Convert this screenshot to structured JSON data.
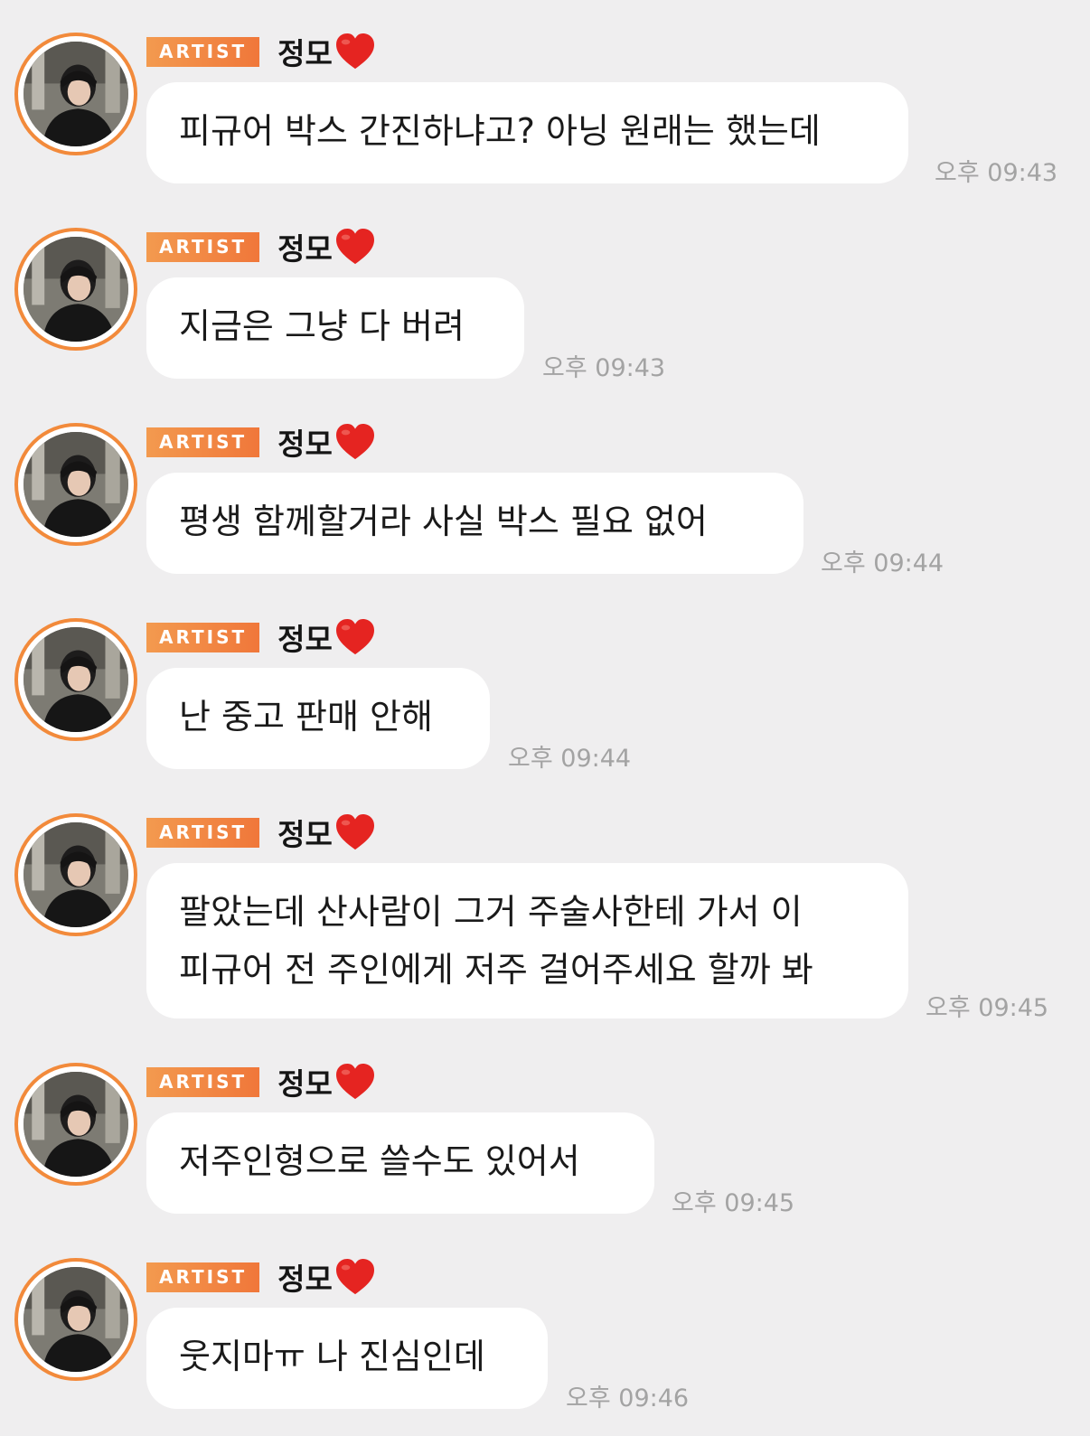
{
  "artist_badge": "ARTIST",
  "sender_name": "정모",
  "icons": {
    "avatar": "profile-photo",
    "heart": "red-heart-emoji"
  },
  "colors": {
    "badge": "#f0773a",
    "avatar_ring": "#f28a3b",
    "background": "#efeeef",
    "bubble": "#ffffff",
    "time": "#a3a3a3"
  },
  "messages": [
    {
      "lines": [
        "피규어 박스 간진하냐고? 아닝 원래는 했는데"
      ],
      "time": "오후 09:43"
    },
    {
      "lines": [
        "지금은 그냥 다 버려"
      ],
      "time": "오후 09:43"
    },
    {
      "lines": [
        "평생 함께할거라 사실 박스 필요 없어"
      ],
      "time": "오후 09:44"
    },
    {
      "lines": [
        "난 중고 판매 안해"
      ],
      "time": "오후 09:44"
    },
    {
      "lines": [
        "팔았는데 산사람이 그거 주술사한테 가서 이",
        "피규어 전 주인에게 저주 걸어주세요 할까 봐"
      ],
      "time": "오후 09:45"
    },
    {
      "lines": [
        "저주인형으로 쓸수도 있어서"
      ],
      "time": "오후 09:45"
    },
    {
      "lines": [
        "웃지마ㅠ 나 진심인데"
      ],
      "time": "오후 09:46"
    }
  ]
}
